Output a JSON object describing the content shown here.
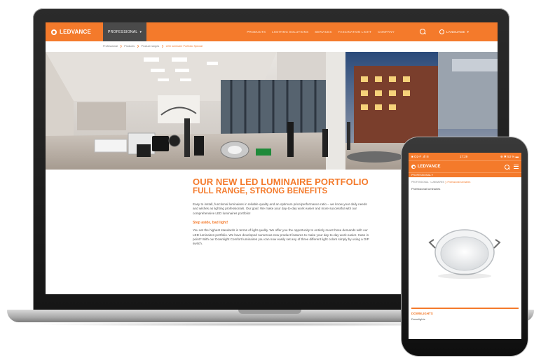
{
  "desktop": {
    "nav": {
      "logo": "LEDVANCE",
      "segment": "PROFESSIONAL",
      "segment_chevron": "▾",
      "menu": [
        "PRODUCTS",
        "LIGHTING SOLUTIONS",
        "SERVICES",
        "FASCINATION LIGHT",
        "COMPANY"
      ],
      "search_icon": "search-icon",
      "language": "LANGUAGE",
      "language_chevron": "▾"
    },
    "breadcrumb": {
      "items": [
        "Professional",
        "Products",
        "Product ranges"
      ],
      "current": "LED luminaire Portfolio Special",
      "separator": "❯"
    },
    "article": {
      "heading": "OUR NEW LED LUMINAIRE PORTFOLIO",
      "subheading": "FULL RANGE, STRONG BENEFITS",
      "paragraph1": "Easy to install, functional luminaires in reliable quality and an optimum price/performance ratio – we know your daily needs and wishes as lighting professionals. Our goal: We make your day-to-day work easier and more successful with our comprehensive LED luminaires portfolio!",
      "subtitle": "Step aside, bad light!",
      "paragraph2": "You set the highest standards in terms of light quality. We offer you the opportunity to entirely meet those demands with our LED luminaires portfolio. We have developed numerous new product features to make your day-to-day work easier. Case in point? With our Downlight Comfort luminaires you can now easily set any of three different light colors simply by using a DIP switch."
    }
  },
  "phone": {
    "status": {
      "left": "■ O2-F  .ıll  ≋",
      "time": "17:29",
      "right": "⊕ ✱ 53 % ▬"
    },
    "nav": {
      "logo": "LEDVANCE"
    },
    "segment": "PROFESSIONAL  ▾",
    "breadcrumb": {
      "items": "PROFESSIONAL · LUMINAIRES",
      "current": "Professional luminaires",
      "separator": "❯"
    },
    "title": "Professional luminaires",
    "category": "DOWNLIGHTS",
    "category_sub": "Downlights"
  },
  "colors": {
    "brand_orange": "#f47a2b",
    "segment_gray": "#4a4a4a",
    "device_dark": "#1b1b1b"
  }
}
